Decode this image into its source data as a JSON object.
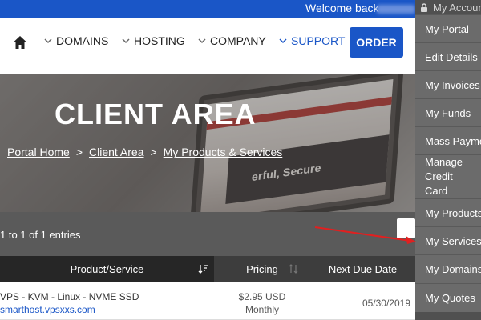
{
  "topbar": {
    "welcome": "Welcome back",
    "bg": "#1a56c7"
  },
  "nav": {
    "home_icon": "home-icon",
    "items": [
      {
        "label": "DOMAINS",
        "icon": "chevron-down-icon"
      },
      {
        "label": "HOSTING",
        "icon": "chevron-down-icon"
      },
      {
        "label": "COMPANY",
        "icon": "chevron-down-icon"
      },
      {
        "label": "SUPPORT",
        "icon": "chevron-down-icon",
        "active": true
      }
    ],
    "order_label": "ORDER"
  },
  "hero": {
    "title": "CLIENT AREA",
    "screen_caption": "erful, Secure",
    "breadcrumb": [
      "Portal Home",
      "Client Area",
      "My Products & Services"
    ],
    "separator": ">"
  },
  "table": {
    "entries_info": "1 to 1 of 1 entries",
    "headers": {
      "product": "Product/Service",
      "pricing": "Pricing",
      "due": "Next Due Date"
    },
    "rows": [
      {
        "product": "VPS - KVM - Linux - NVME SSD",
        "host": "smarthost.vpsxxs.com",
        "price": "$2.95 USD",
        "cycle": "Monthly",
        "due": "05/30/2019"
      }
    ]
  },
  "account_menu": {
    "header": "My Account",
    "header_icon": "lock-icon",
    "items": [
      "My Portal",
      "Edit Details",
      "My Invoices",
      "My Funds",
      "Mass Payment",
      "Manage Credit Card",
      "My Products",
      "My Services",
      "My Domains",
      "My Quotes"
    ]
  },
  "colors": {
    "accent": "#1a56c7",
    "menu_bg": "#6b6b6b",
    "arrow": "#e02020"
  }
}
